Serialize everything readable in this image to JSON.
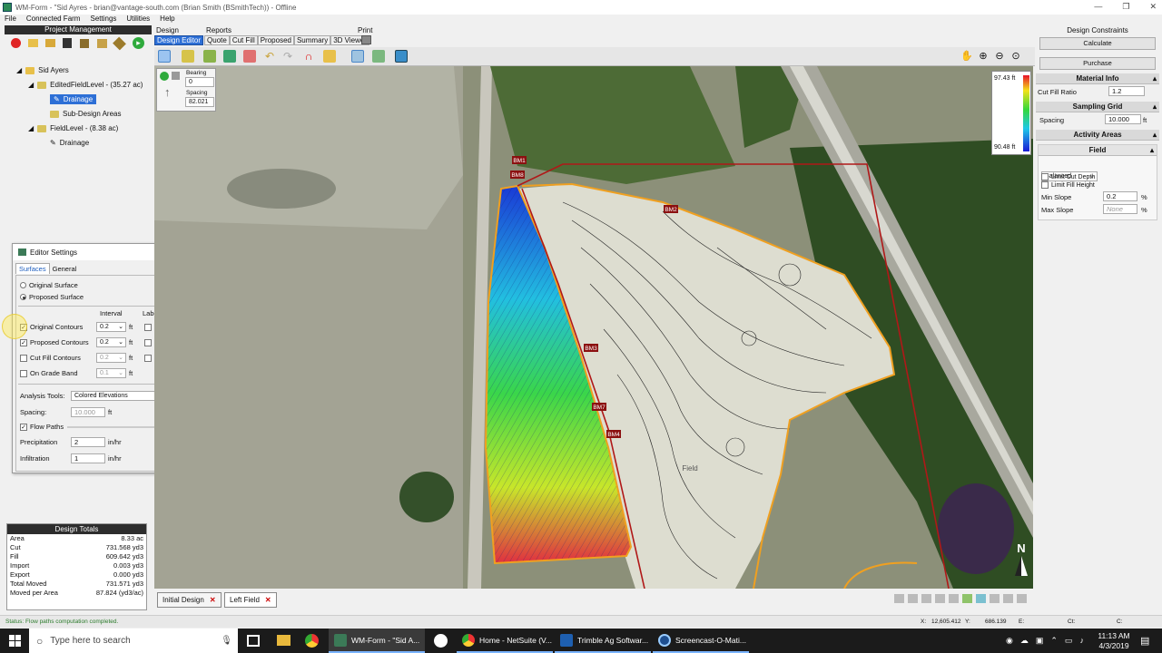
{
  "window": {
    "title": "WM-Form - \"Sid Ayres - brian@vantage-south.com (Brian Smith (BSmithTech)) - Offline"
  },
  "menu": [
    "File",
    "Connected Farm",
    "Settings",
    "Utilities",
    "Help"
  ],
  "project_management": {
    "title": "Project Management",
    "tree": [
      {
        "label": "Sid Ayers"
      },
      {
        "label": "EditedFieldLevel - (35.27 ac)"
      },
      {
        "label": "Drainage",
        "selected": true
      },
      {
        "label": "Sub-Design Areas"
      },
      {
        "label": "FieldLevel - (8.38 ac)"
      },
      {
        "label": "Drainage"
      }
    ]
  },
  "ribbon": {
    "groups": [
      "Design",
      "Reports",
      "Print"
    ],
    "tabs": [
      "Design Editor",
      "Quote",
      "Cut Fill",
      "Proposed",
      "Summary",
      "3D Viewer"
    ]
  },
  "compass": {
    "bearing_label": "Bearing",
    "bearing": "0",
    "spacing_label": "Spacing",
    "spacing": "82.021"
  },
  "legend": {
    "max": "97.43 ft",
    "min": "90.48 ft"
  },
  "map": {
    "markers": [
      "BM1",
      "BM8",
      "BM2",
      "BM3",
      "BM7",
      "BM4"
    ],
    "field_label": "Field",
    "north": "N"
  },
  "editor_settings": {
    "title": "Editor Settings",
    "tabs": [
      "Surfaces",
      "General"
    ],
    "surface_options": [
      "Original Surface",
      "Proposed Surface"
    ],
    "col_interval": "Interval",
    "col_label": "Label",
    "contours": [
      {
        "label": "Original Contours",
        "value": "0.2",
        "unit": "ft"
      },
      {
        "label": "Proposed Contours",
        "value": "0.2",
        "unit": "ft"
      },
      {
        "label": "Cut Fill Contours",
        "value": "0.2",
        "unit": "ft"
      },
      {
        "label": "On Grade Band",
        "value": "0.1",
        "unit": "ft"
      }
    ],
    "analysis_label": "Analysis Tools:",
    "analysis_value": "Colored Elevations",
    "spacing_label": "Spacing:",
    "spacing_value": "10.000",
    "spacing_unit": "ft",
    "flow_paths": "Flow Paths",
    "precip_label": "Precipitation",
    "precip_value": "2",
    "infil_label": "Infiltration",
    "infil_value": "1",
    "rate_unit": "in/hr"
  },
  "design_totals": {
    "title": "Design Totals",
    "rows": [
      {
        "k": "Area",
        "v": "8.33 ac"
      },
      {
        "k": "Cut",
        "v": "731.568 yd3"
      },
      {
        "k": "Fill",
        "v": "609.642 yd3"
      },
      {
        "k": "Import",
        "v": "0.003 yd3"
      },
      {
        "k": "Export",
        "v": "0.000 yd3"
      },
      {
        "k": "Total Moved",
        "v": "731.571 yd3"
      },
      {
        "k": "Moved per Area",
        "v": "87.824 (yd3/ac)"
      }
    ]
  },
  "bottom_tabs": [
    "Initial Design",
    "Left Field"
  ],
  "status": {
    "text": "Status: Flow paths computation completed.",
    "x_label": "X:",
    "x": "12,605.412",
    "y_label": "Y:",
    "y": "686.139",
    "e_label": "E:",
    "ct_label": "Ct:",
    "c_label": "C:"
  },
  "design_constraints": {
    "title": "Design Constraints",
    "calculate": "Calculate",
    "purchase": "Purchase",
    "material_info": "Material Info",
    "cut_fill_ratio_label": "Cut Fill Ratio",
    "cut_fill_ratio": "1.2",
    "sampling_grid": "Sampling Grid",
    "spacing_label": "Spacing",
    "spacing": "10.000",
    "spacing_unit": "ft",
    "activity_areas": "Activity Areas",
    "field": "Field",
    "mode": "Balanced",
    "limit_cut": "Limit Cut Depth",
    "limit_fill": "Limit Fill Height",
    "min_slope_label": "Min Slope",
    "min_slope": "0.2",
    "max_slope_label": "Max Slope",
    "max_slope": "None",
    "pct": "%"
  },
  "taskbar": {
    "search": "Type here to search",
    "apps": [
      "WM-Form - \"Sid A...",
      "Home - NetSuite (V...",
      "Trimble Ag Softwar...",
      "Screencast-O-Mati..."
    ],
    "time": "11:13 AM",
    "date": "4/3/2019"
  }
}
